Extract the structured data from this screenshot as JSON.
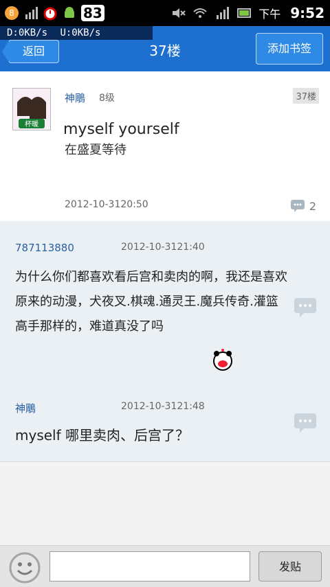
{
  "status_bar": {
    "notification_count": "83",
    "ampm": "下午",
    "time": "9:52"
  },
  "netspeed": {
    "download": "D:0KB/s",
    "upload": "U:0KB/s"
  },
  "header": {
    "back_label": "返回",
    "title": "37楼",
    "bookmark_label": "添加书签"
  },
  "post": {
    "author": "神鵰",
    "level": "8级",
    "floor": "37楼",
    "title": "myself yourself",
    "subtitle": "在盛夏等待",
    "time": "2012-10-3120:50",
    "comment_count": "2"
  },
  "replies": [
    {
      "user": "787113880",
      "time": "2012-10-3121:40",
      "text": "为什么你们都喜欢看后宫和卖肉的啊，我还是喜欢原来的动漫，犬夜叉.棋魂.通灵王.魔兵传奇.灌篮高手那样的，难道真没了吗"
    },
    {
      "user": "神鵰",
      "time": "2012-10-3121:48",
      "text": "myself 哪里卖肉、后宫了？"
    }
  ],
  "bottom": {
    "input_placeholder": "",
    "send_label": "发贴"
  }
}
